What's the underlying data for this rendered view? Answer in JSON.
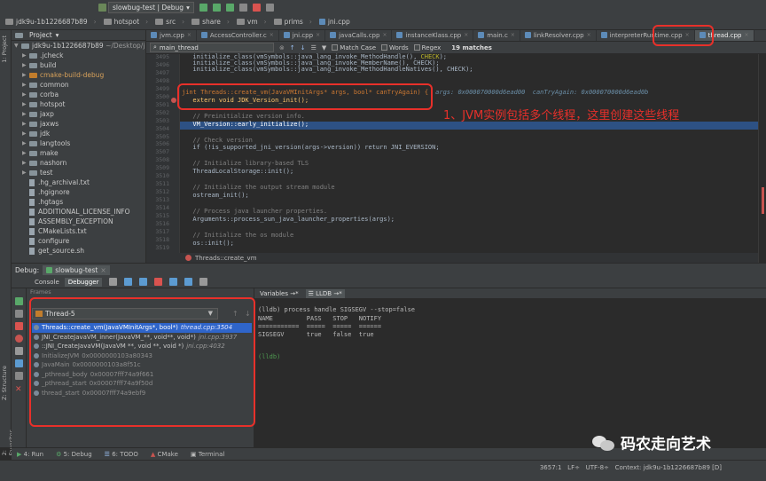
{
  "nav": {
    "crumbs": [
      "jdk9u-1b1226687b89",
      "hotspot",
      "src",
      "share",
      "vm",
      "prims",
      "jni.cpp"
    ],
    "run_config": "slowbug-test | Debug"
  },
  "project": {
    "header": "Project",
    "root": "jdk9u-1b1226687b89",
    "root_path": "~/Desktop/j",
    "items": [
      {
        "label": ".jcheck",
        "kind": "folder"
      },
      {
        "label": "build",
        "kind": "folder"
      },
      {
        "label": "cmake-build-debug",
        "kind": "folder-orange"
      },
      {
        "label": "common",
        "kind": "folder"
      },
      {
        "label": "corba",
        "kind": "folder"
      },
      {
        "label": "hotspot",
        "kind": "folder"
      },
      {
        "label": "jaxp",
        "kind": "folder"
      },
      {
        "label": "jaxws",
        "kind": "folder"
      },
      {
        "label": "jdk",
        "kind": "folder"
      },
      {
        "label": "langtools",
        "kind": "folder"
      },
      {
        "label": "make",
        "kind": "folder"
      },
      {
        "label": "nashorn",
        "kind": "folder"
      },
      {
        "label": "test",
        "kind": "folder"
      },
      {
        "label": ".hg_archival.txt",
        "kind": "file"
      },
      {
        "label": ".hgignore",
        "kind": "file"
      },
      {
        "label": ".hgtags",
        "kind": "file"
      },
      {
        "label": "ADDITIONAL_LICENSE_INFO",
        "kind": "file"
      },
      {
        "label": "ASSEMBLY_EXCEPTION",
        "kind": "file"
      },
      {
        "label": "CMakeLists.txt",
        "kind": "file"
      },
      {
        "label": "configure",
        "kind": "file"
      },
      {
        "label": "get_source.sh",
        "kind": "file"
      }
    ]
  },
  "tabs": [
    "jvm.cpp",
    "AccessController.c",
    "jni.cpp",
    "javaCalls.cpp",
    "instanceKlass.cpp",
    "main.c",
    "linkResolver.cpp",
    "interpreterRuntime.cpp",
    "thread.cpp"
  ],
  "find": {
    "query": "main_thread",
    "match_case": "Match Case",
    "words": "Words",
    "regex": "Regex",
    "matches": "19 matches"
  },
  "editor": {
    "line_numbers": [
      "3495",
      "3496",
      "3497",
      "3498",
      "3499",
      "3500",
      "3501",
      "3502",
      "3503",
      "3504",
      "3505",
      "3506",
      "3507",
      "3508",
      "3509",
      "3510",
      "3511",
      "3512",
      "3513",
      "3514",
      "3515",
      "3516",
      "3517",
      "3518",
      "3519",
      "3520"
    ],
    "lines": {
      "l3496": "  initialize_class(vmSymbols::java_lang_invoke_MemberName(), CHECK);",
      "l3497": "  initialize_class(vmSymbols::java_lang_invoke_MethodHandleNatives(), CHECK);",
      "l3500_sig": "jint Threads::create_vm(JavaVMInitArgs* args, bool* canTryAgain) {",
      "l3500_inline": "args: 0x000070000d6ead00  canTryAgain: 0x000070000d6ead0b",
      "l3501": "  extern void JDK_Version_init();",
      "l3503": "  // Preinitialize version info.",
      "l3504": "  VM_Version::early_initialize();",
      "l3506": "  // Check version",
      "l3507": "  if (!is_supported_jni_version(args->version)) return JNI_EVERSION;",
      "l3509": "  // Initialize library-based TLS",
      "l3510": "  ThreadLocalStorage::init();",
      "l3512": "  // Initialize the output stream module",
      "l3513": "  ostream_init();",
      "l3515": "  // Process java launcher properties.",
      "l3516": "  Arguments::process_sun_java_launcher_properties(args);",
      "l3518": "  // Initialize the os module",
      "l3519": "  os::init();"
    },
    "breadcrumb": "Threads::create_vm"
  },
  "annotation": "1、JVM实例包括多个线程，这里创建这些线程",
  "debug": {
    "label": "Debug:",
    "config": "slowbug-test",
    "tab_console": "Console",
    "tab_debugger": "Debugger",
    "frames_header": "Frames",
    "thread": "Thread-5",
    "frames": [
      {
        "name": "Threads::create_vm(JavaVMInitArgs*, bool*)",
        "loc": "thread.cpp:3504",
        "selected": true
      },
      {
        "name": "JNI_CreateJavaVM_inner(JavaVM_**, void**, void*)",
        "loc": "jni.cpp:3937"
      },
      {
        "name": "::JNI_CreateJavaVM(JavaVM **, void **, void *)",
        "loc": "jni.cpp:4032"
      },
      {
        "name": "InitializeJVM",
        "loc": "0x0000000103a80343",
        "dim": true
      },
      {
        "name": "JavaMain",
        "loc": "0x0000000103a8f51c",
        "dim": true
      },
      {
        "name": "_pthread_body",
        "loc": "0x00007fff74a9f661",
        "dim": true
      },
      {
        "name": "_pthread_start",
        "loc": "0x00007fff74a9f50d",
        "dim": true
      },
      {
        "name": "thread_start",
        "loc": "0x00007fff74a9ebf9",
        "dim": true
      }
    ],
    "vars_tab": "Variables",
    "lldb_tab": "LLDB",
    "lldb": {
      "cmd": "(lldb) process handle SIGSEGV --stop=false",
      "header": "NAME         PASS   STOP   NOTIFY",
      "rule": "===========  =====  =====  ======",
      "row": "SIGSEGV      true   false  true",
      "prompt": "(lldb)"
    }
  },
  "bottom_tabs": [
    "4: Run",
    "6: TODO",
    "CMake",
    "Terminal"
  ],
  "status": {
    "position": "3657:1",
    "line_sep": "LF÷",
    "encoding": "UTF-8÷",
    "context": "Context: jdk9u-1b1226687b89 [D]"
  },
  "sidebar_tabs": {
    "project": "1: Project",
    "structure": "Z: Structure",
    "favorites": "2: Favorites"
  },
  "watermark": "码农走向艺术",
  "colors": {
    "highlight_box": "#e8302a",
    "exec_line": "#2d5184",
    "selected_frame": "#2f65ca"
  }
}
